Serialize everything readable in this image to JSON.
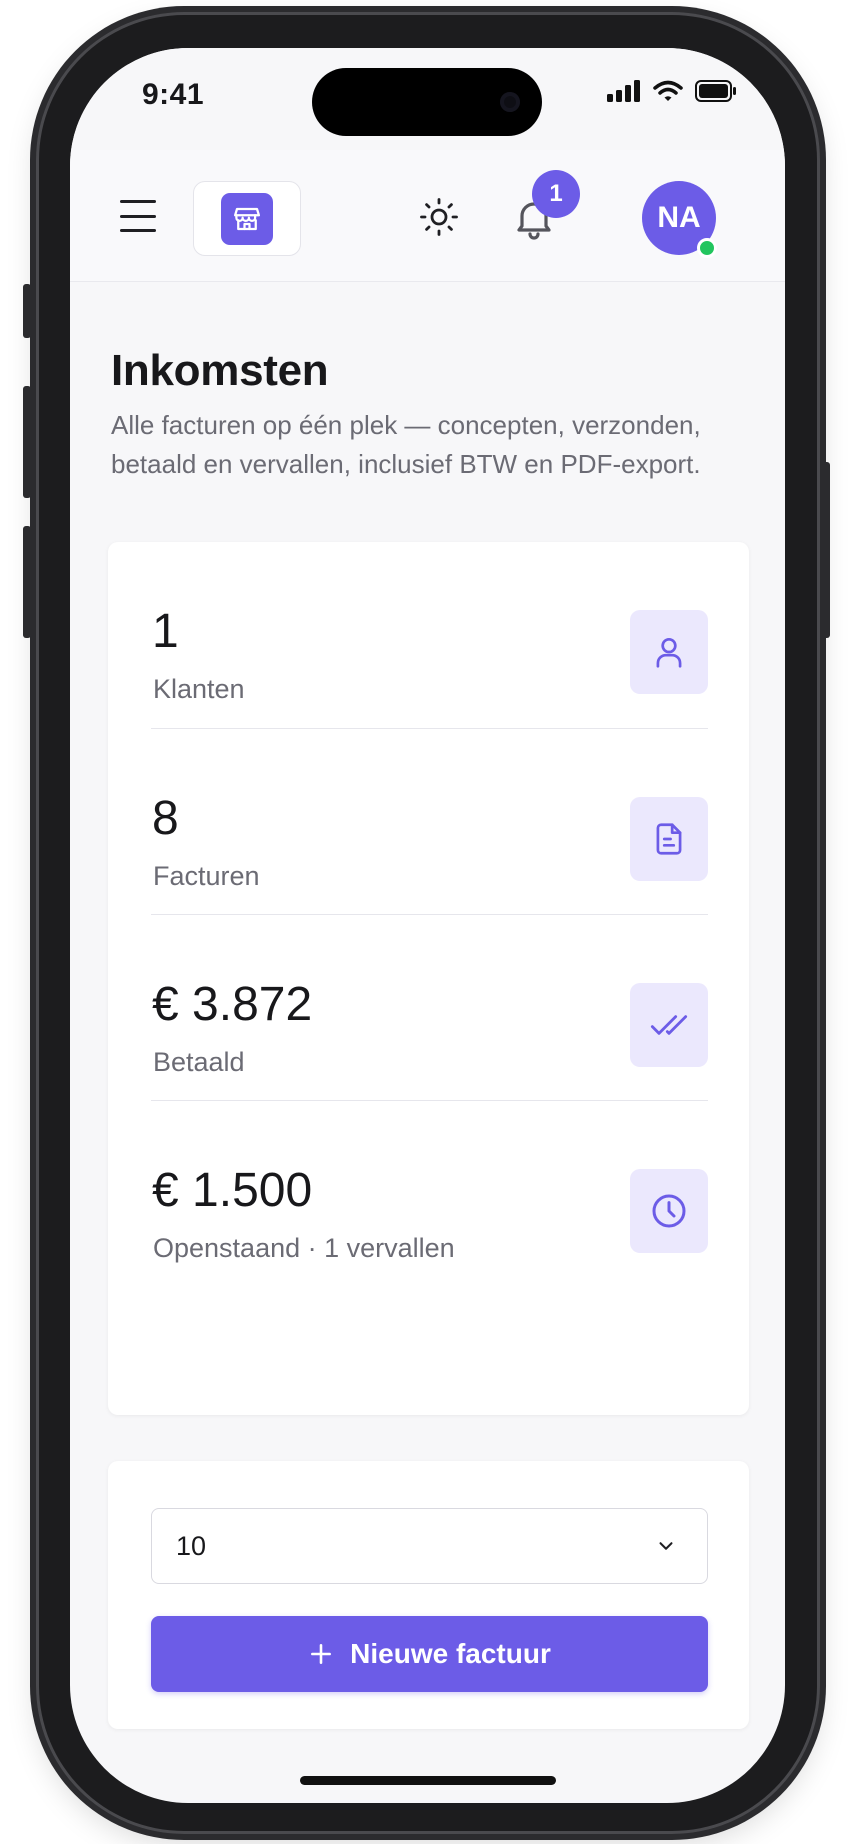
{
  "status_bar": {
    "time": "9:41"
  },
  "header": {
    "logo_icon": "store-icon",
    "theme_icon": "sun-icon",
    "notification_icon": "bell-icon",
    "notification_count": "1",
    "avatar_initials": "NA",
    "avatar_status": "online",
    "accent_color": "#6c5ce7"
  },
  "page": {
    "title": "Inkomsten",
    "subtitle": "Alle facturen op één plek — concepten, verzonden, betaald en vervallen, inclusief BTW en PDF-export."
  },
  "stats": [
    {
      "value": "1",
      "label": "Klanten",
      "icon": "user-icon"
    },
    {
      "value": "8",
      "label": "Facturen",
      "icon": "document-icon"
    },
    {
      "value": "€ 3.872",
      "label": "Betaald",
      "icon": "double-check-icon"
    },
    {
      "value": "€ 1.500",
      "label": "Openstaand · 1 vervallen",
      "icon": "clock-icon"
    }
  ],
  "actions": {
    "page_size": "10",
    "new_invoice_label": "Nieuwe factuur"
  }
}
